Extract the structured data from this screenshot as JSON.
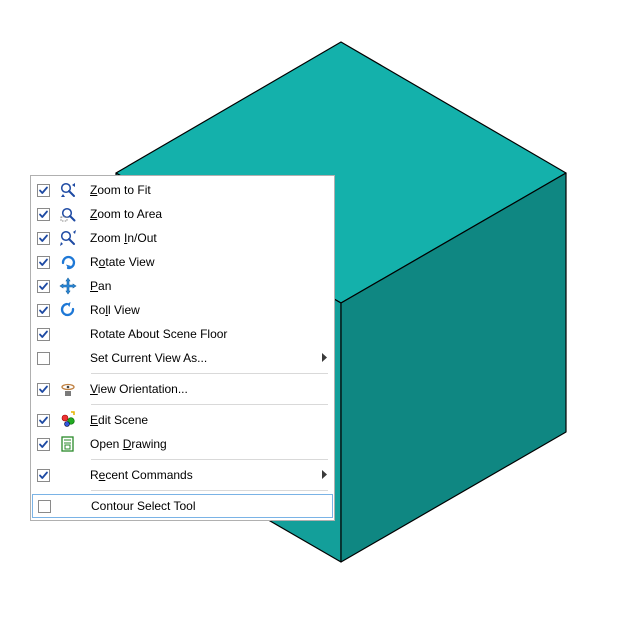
{
  "cube": {
    "top_fill": "#14b1ab",
    "left_fill": "#139f9a",
    "right_fill": "#0f8782",
    "stroke": "#000000"
  },
  "menu": {
    "items": [
      {
        "id": "zoom-fit",
        "checked": true,
        "icon": "zoom-fit-icon",
        "label": "Zoom to Fit",
        "underline_index": 0,
        "has_submenu": false
      },
      {
        "id": "zoom-area",
        "checked": true,
        "icon": "zoom-area-icon",
        "label": "Zoom to Area",
        "underline_index": 0,
        "has_submenu": false
      },
      {
        "id": "zoom-in-out",
        "checked": true,
        "icon": "zoom-in-out-icon",
        "label": "Zoom In/Out",
        "underline_index": 5,
        "has_submenu": false
      },
      {
        "id": "rotate-view",
        "checked": true,
        "icon": "rotate-view-icon",
        "label": "Rotate View",
        "underline_index": 1,
        "has_submenu": false
      },
      {
        "id": "pan",
        "checked": true,
        "icon": "pan-icon",
        "label": "Pan",
        "underline_index": 0,
        "has_submenu": false
      },
      {
        "id": "roll-view",
        "checked": true,
        "icon": "roll-view-icon",
        "label": "Roll View",
        "underline_index": 2,
        "has_submenu": false
      },
      {
        "id": "rotate-scene",
        "checked": true,
        "icon": null,
        "label": "Rotate About Scene Floor",
        "underline_index": null,
        "has_submenu": false
      },
      {
        "id": "set-view-as",
        "checked": false,
        "icon": null,
        "label": "Set Current View As...",
        "underline_index": null,
        "has_submenu": true
      },
      {
        "separator": true
      },
      {
        "id": "view-orient",
        "checked": true,
        "icon": "view-orient-icon",
        "label": "View Orientation...",
        "underline_index": 0,
        "has_submenu": false
      },
      {
        "separator": true
      },
      {
        "id": "edit-scene",
        "checked": true,
        "icon": "edit-scene-icon",
        "label": "Edit Scene",
        "underline_index": 0,
        "has_submenu": false
      },
      {
        "id": "open-drawing",
        "checked": true,
        "icon": "open-drawing-icon",
        "label": "Open Drawing",
        "underline_index": 5,
        "has_submenu": false
      },
      {
        "separator": true
      },
      {
        "id": "recent-cmds",
        "checked": true,
        "icon": null,
        "label": "Recent Commands",
        "underline_index": 1,
        "has_submenu": true
      },
      {
        "separator": true
      },
      {
        "id": "contour-select",
        "checked": false,
        "icon": null,
        "label": "Contour Select Tool",
        "underline_index": null,
        "has_submenu": false,
        "highlighted": true
      }
    ]
  }
}
